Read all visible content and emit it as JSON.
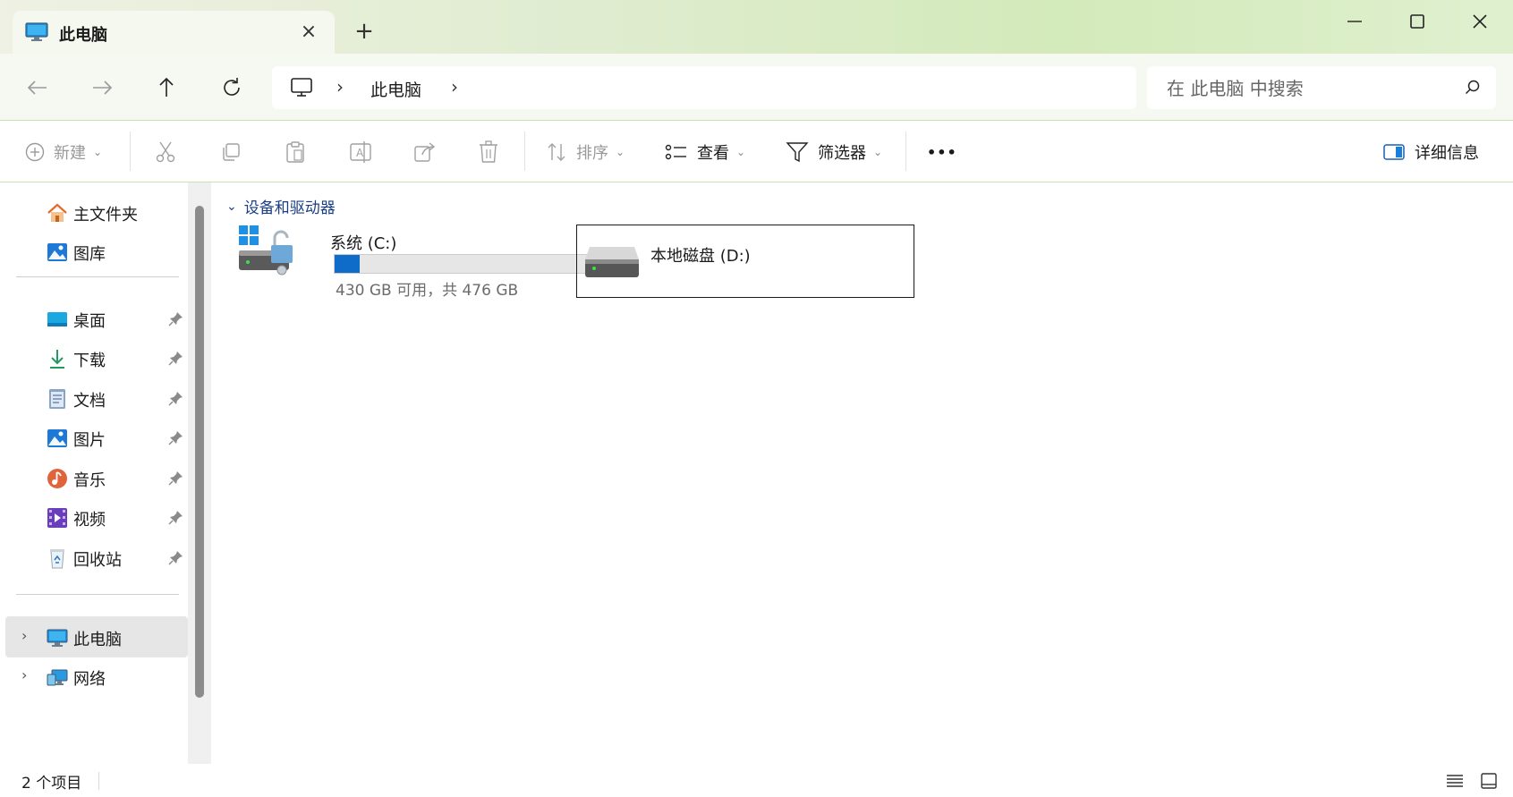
{
  "tab": {
    "title": "此电脑",
    "icon": "monitor-icon"
  },
  "window_controls": {
    "minimize": "minimize-icon",
    "maximize": "maximize-icon",
    "close": "close-icon"
  },
  "address": {
    "crumb": "此电脑",
    "placeholder": "在 此电脑 中搜索"
  },
  "toolbar": {
    "new": "新建",
    "sort": "排序",
    "view": "查看",
    "filter": "筛选器",
    "more": "•••",
    "details": "详细信息"
  },
  "sidebar": {
    "home": "主文件夹",
    "gallery": "图库",
    "pinned": [
      {
        "label": "桌面",
        "icon": "desktop-icon"
      },
      {
        "label": "下载",
        "icon": "download-icon"
      },
      {
        "label": "文档",
        "icon": "document-icon"
      },
      {
        "label": "图片",
        "icon": "pictures-icon"
      },
      {
        "label": "音乐",
        "icon": "music-icon"
      },
      {
        "label": "视频",
        "icon": "video-icon"
      },
      {
        "label": "回收站",
        "icon": "recycle-bin-icon"
      }
    ],
    "this_pc": "此电脑",
    "network": "网络"
  },
  "content": {
    "group_title": "设备和驱动器",
    "drives": [
      {
        "name": "系统 (C:)",
        "free": "430 GB 可用，共 476 GB",
        "used_fraction": 0.097
      },
      {
        "name": "本地磁盘 (D:)"
      }
    ]
  },
  "status": {
    "count": "2 个项目"
  },
  "colors": {
    "accent": "#0f6cc8",
    "titlebar": "#d3eaba",
    "selection": "#e6e6e6",
    "group_header": "#1a3e86"
  }
}
